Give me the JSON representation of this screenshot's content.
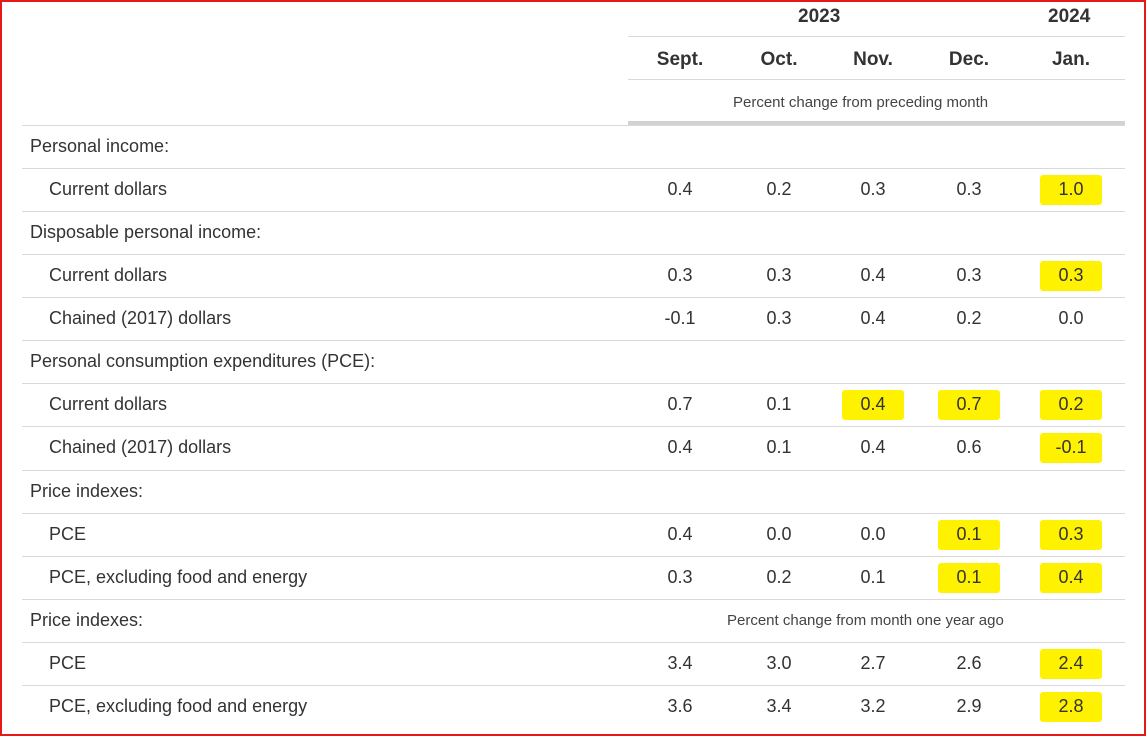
{
  "header": {
    "years": [
      "2023",
      "2024"
    ],
    "months": [
      "Sept.",
      "Oct.",
      "Nov.",
      "Dec.",
      "Jan."
    ],
    "subheader": "Percent change from preceding month"
  },
  "rows": [
    {
      "label": "Personal income:",
      "section": true,
      "values": []
    },
    {
      "label": "Current dollars",
      "section": false,
      "values": [
        "0.4",
        "0.2",
        "0.3",
        "0.3",
        "1.0"
      ]
    },
    {
      "label": "Disposable personal income:",
      "section": true,
      "values": []
    },
    {
      "label": "Current dollars",
      "section": false,
      "values": [
        "0.3",
        "0.3",
        "0.4",
        "0.3",
        "0.3"
      ]
    },
    {
      "label": "Chained (2017) dollars",
      "section": false,
      "values": [
        "-0.1",
        "0.3",
        "0.4",
        "0.2",
        "0.0"
      ]
    },
    {
      "label": "Personal consumption expenditures (PCE):",
      "section": true,
      "values": []
    },
    {
      "label": "Current dollars",
      "section": false,
      "values": [
        "0.7",
        "0.1",
        "0.4",
        "0.7",
        "0.2"
      ]
    },
    {
      "label": "Chained (2017) dollars",
      "section": false,
      "values": [
        "0.4",
        "0.1",
        "0.4",
        "0.6",
        "-0.1"
      ]
    },
    {
      "label": "Price indexes:",
      "section": true,
      "values": []
    },
    {
      "label": "PCE",
      "section": false,
      "values": [
        "0.4",
        "0.0",
        "0.0",
        "0.1",
        "0.3"
      ]
    },
    {
      "label": "PCE, excluding food and energy",
      "section": false,
      "values": [
        "0.3",
        "0.2",
        "0.1",
        "0.1",
        "0.4"
      ]
    },
    {
      "label": "Price indexes:",
      "section": true,
      "values": [],
      "note": "Percent change from month one year ago"
    },
    {
      "label": "PCE",
      "section": false,
      "values": [
        "3.4",
        "3.0",
        "2.7",
        "2.6",
        "2.4"
      ]
    },
    {
      "label": "PCE, excluding food and energy",
      "section": false,
      "values": [
        "3.6",
        "3.4",
        "3.2",
        "2.9",
        "2.8"
      ]
    }
  ],
  "highlights": [
    {
      "row": 1,
      "col": 4
    },
    {
      "row": 3,
      "col": 4
    },
    {
      "row": 6,
      "col": 2
    },
    {
      "row": 6,
      "col": 3
    },
    {
      "row": 6,
      "col": 4
    },
    {
      "row": 7,
      "col": 4
    },
    {
      "row": 9,
      "col": 3
    },
    {
      "row": 9,
      "col": 4
    },
    {
      "row": 10,
      "col": 3
    },
    {
      "row": 10,
      "col": 4
    },
    {
      "row": 12,
      "col": 4
    },
    {
      "row": 13,
      "col": 4
    }
  ],
  "colors": {
    "highlight": "#fff200",
    "frame_border": "#e81818",
    "rule": "#d9d9d9"
  }
}
